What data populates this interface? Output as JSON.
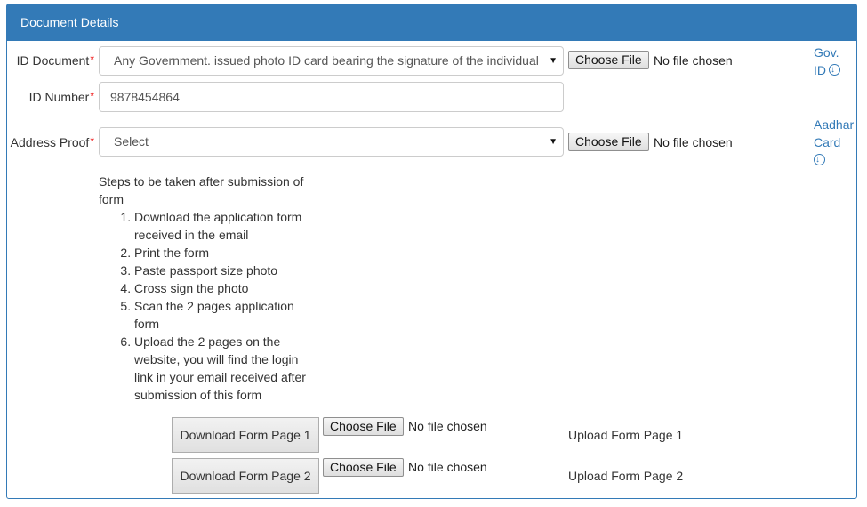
{
  "panel": {
    "title": "Document Details"
  },
  "id_document": {
    "label": "ID Document",
    "required": "*",
    "selected": "Any Government. issued photo ID card bearing the signature of the individual",
    "file_button": "Choose File",
    "file_status": "No file chosen",
    "link_line1": "Gov.",
    "link_line2": "ID"
  },
  "id_number": {
    "label": "ID Number",
    "required": "*",
    "value": "9878454864"
  },
  "address_proof": {
    "label": "Address Proof",
    "required": "*",
    "selected": "Select",
    "file_button": "Choose File",
    "file_status": "No file chosen",
    "link_line1": "Aadhar",
    "link_line2": "Card"
  },
  "instructions": {
    "heading": "Steps to be taken after submission of form",
    "steps": [
      "Download the application form received in the email",
      "Print the form",
      "Paste passport size photo",
      "Cross sign the photo",
      "Scan the 2 pages application form",
      "Upload the 2 pages on the website, you will find the login link in your email received after submission of this form"
    ]
  },
  "form_pages": [
    {
      "download_label": "Download Form Page 1",
      "file_button": "Choose File",
      "file_status": "No file chosen",
      "upload_label": "Upload Form Page 1"
    },
    {
      "download_label": "Download Form Page 2",
      "file_button": "Choose File",
      "file_status": "No file chosen",
      "upload_label": "Upload Form Page 2"
    }
  ],
  "icons": {
    "download": "download-circle-icon",
    "dropdown": "caret-down-icon"
  },
  "colors": {
    "accent": "#337ab7",
    "required": "#ee0000"
  }
}
